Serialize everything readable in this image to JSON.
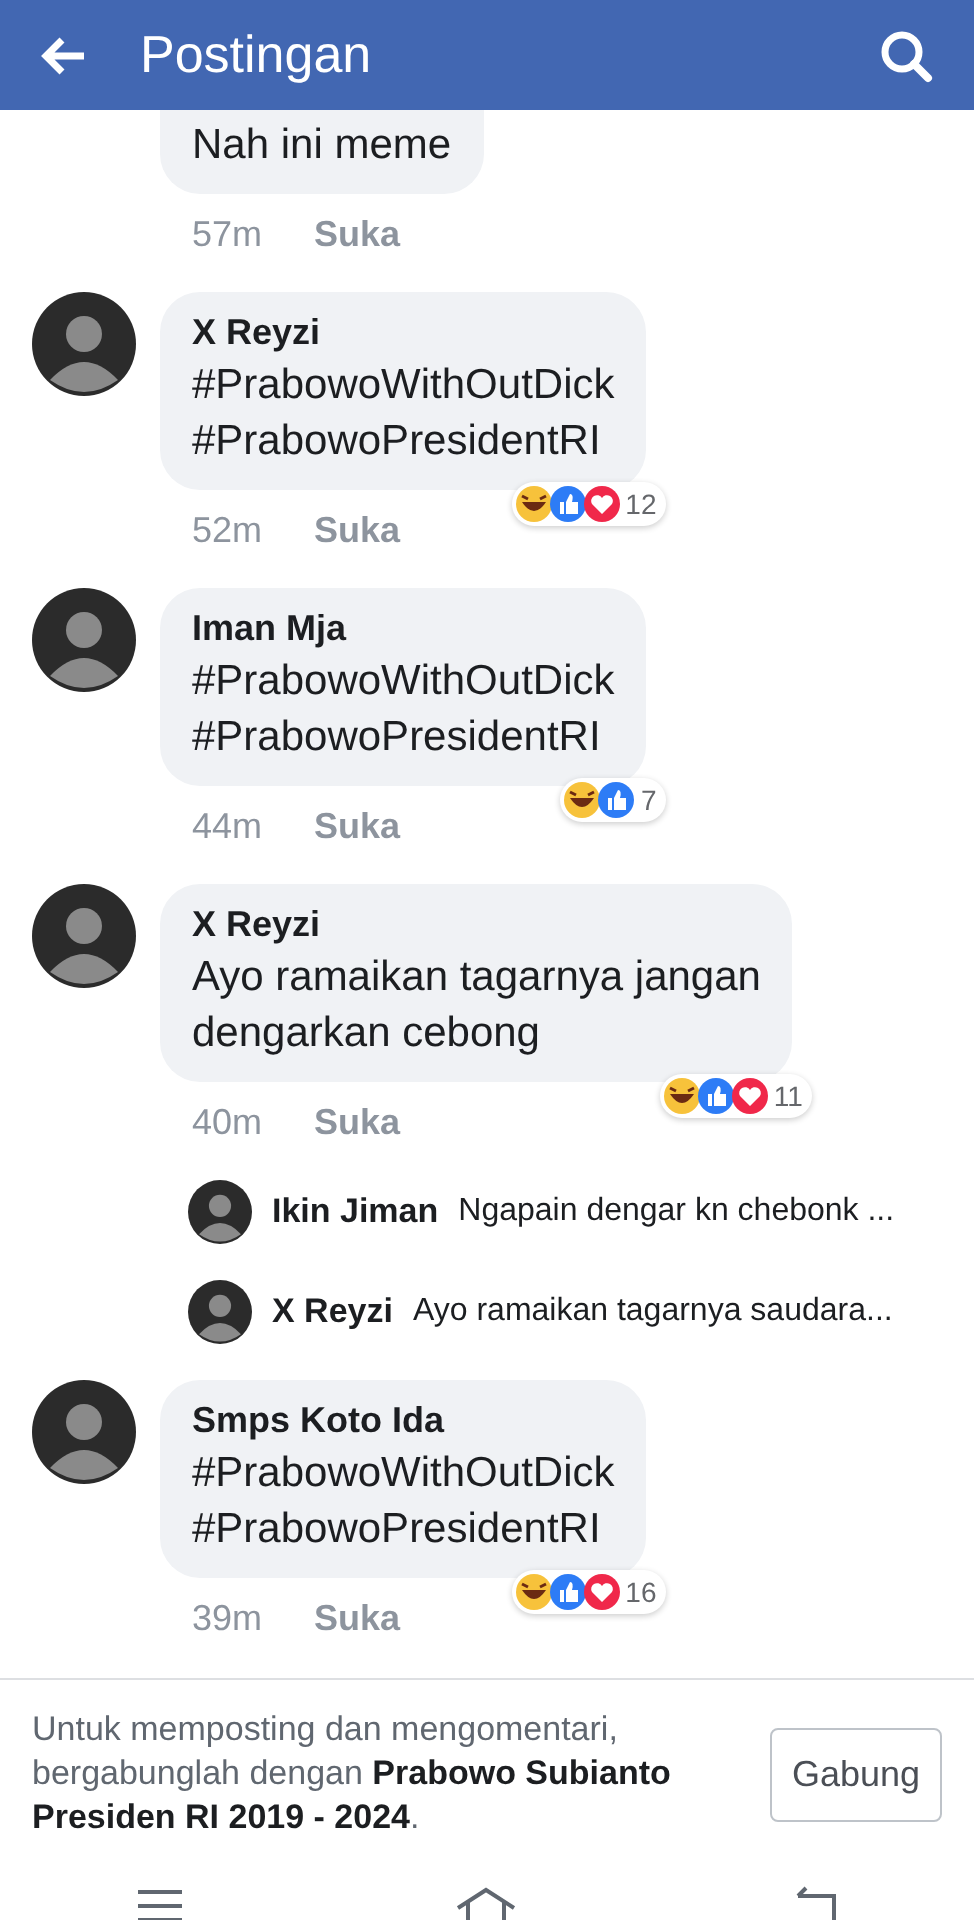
{
  "header": {
    "title": "Postingan"
  },
  "comments": [
    {
      "kind": "comment",
      "text": "Nah ini meme",
      "time": "57m",
      "like": "Suka"
    },
    {
      "kind": "comment",
      "author": "X Reyzi",
      "text": "#PrabowoWithOutDick\n#PrabowoPresidentRI",
      "time": "52m",
      "like": "Suka",
      "reactions": {
        "types": [
          {
            "kind": "haha"
          },
          {
            "kind": "like"
          },
          {
            "kind": "love"
          }
        ],
        "count": "12"
      }
    },
    {
      "kind": "comment",
      "author": "Iman Mja",
      "text": "#PrabowoWithOutDick\n#PrabowoPresidentRI",
      "time": "44m",
      "like": "Suka",
      "reactions": {
        "types": [
          {
            "kind": "haha"
          },
          {
            "kind": "like"
          }
        ],
        "count": "7"
      }
    },
    {
      "kind": "comment",
      "author": "X Reyzi",
      "text": "Ayo ramaikan tagarnya jangan\ndengarkan cebong",
      "time": "40m",
      "like": "Suka",
      "reactions": {
        "types": [
          {
            "kind": "haha"
          },
          {
            "kind": "like"
          },
          {
            "kind": "love"
          }
        ],
        "count": "11"
      }
    },
    {
      "kind": "reply",
      "author": "Ikin Jiman",
      "text": "Ngapain dengar kn chebonk ..."
    },
    {
      "kind": "reply",
      "author": "X Reyzi",
      "text": "Ayo ramaikan tagarnya saudara..."
    },
    {
      "kind": "comment",
      "author": "Smps Koto Ida",
      "text": "#PrabowoWithOutDick\n#PrabowoPresidentRI",
      "time": "39m",
      "like": "Suka",
      "reactions": {
        "types": [
          {
            "kind": "haha"
          },
          {
            "kind": "like"
          },
          {
            "kind": "love"
          }
        ],
        "count": "16"
      }
    }
  ],
  "join_bar": {
    "message": "Untuk memposting dan mengomentari, bergabunglah dengan **Prabowo Subianto Presiden RI 2019 - 2024**.",
    "button": "Gabung"
  }
}
